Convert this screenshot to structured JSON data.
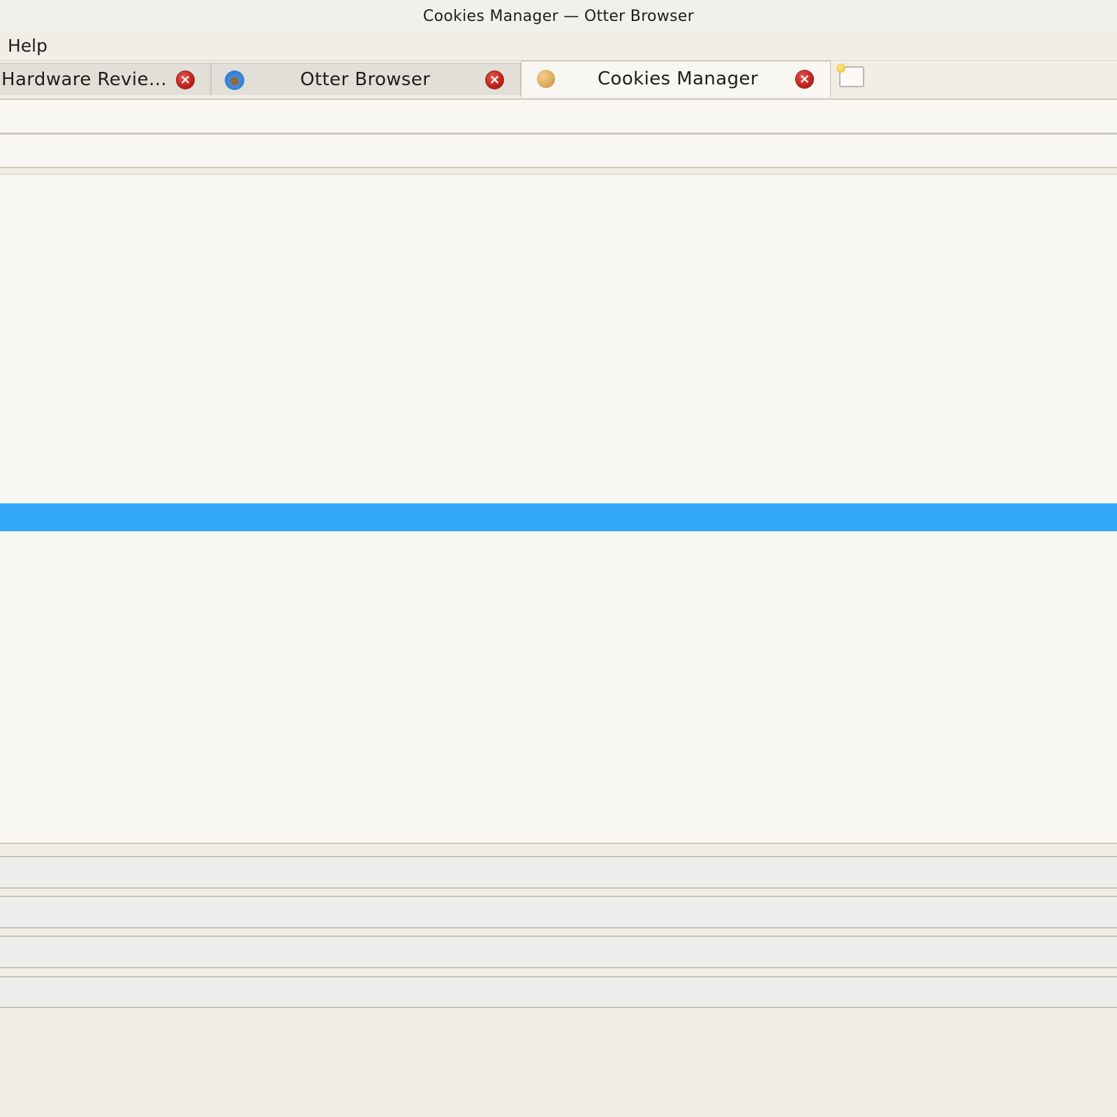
{
  "window": {
    "title": "Cookies Manager — Otter Browser"
  },
  "menubar": {
    "items": [
      {
        "label": "Help"
      }
    ]
  },
  "tabs": [
    {
      "label": "Hardware Revie…",
      "icon": "page-icon",
      "active": false
    },
    {
      "label": "Otter Browser",
      "icon": "otter-icon",
      "active": false
    },
    {
      "label": "Cookies Manager",
      "icon": "cookie-icon",
      "active": true
    }
  ],
  "colors": {
    "selection": "#34a8f8",
    "close_button": "#c4231d",
    "background": "#f8f7f2"
  }
}
